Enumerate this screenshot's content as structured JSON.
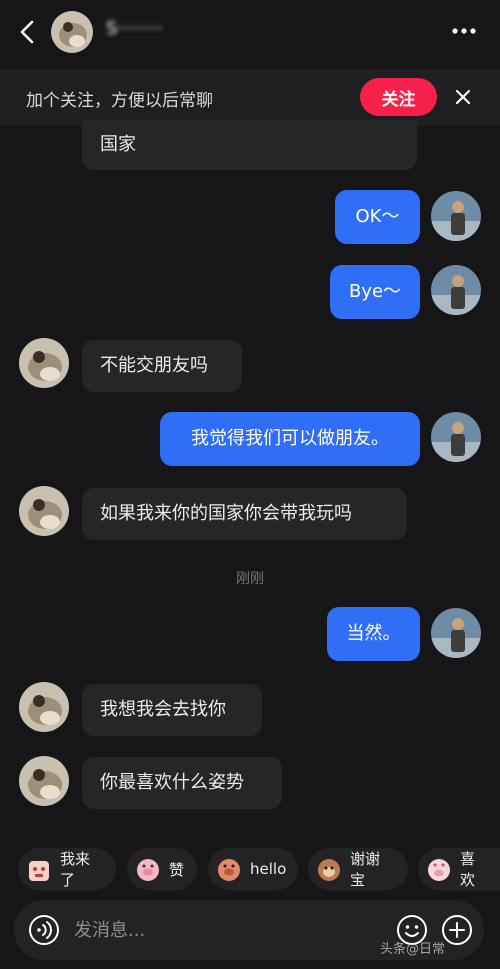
{
  "header": {
    "contact_name": "S········"
  },
  "follow_banner": {
    "text": "加个关注，方便以后常聊",
    "button_label": "关注"
  },
  "messages": [
    {
      "side": "left",
      "text": "国家"
    },
    {
      "side": "right",
      "text": "OK～"
    },
    {
      "side": "right",
      "text": "Bye～"
    },
    {
      "side": "left",
      "text": "不能交朋友吗"
    },
    {
      "side": "right",
      "text": "我觉得我们可以做朋友。"
    },
    {
      "side": "left",
      "text": "如果我来你的国家你会带我玩吗"
    },
    {
      "side": "right",
      "text": "当然。"
    },
    {
      "side": "left",
      "text": "我想我会去找你"
    },
    {
      "side": "left",
      "text": "你最喜欢什么姿势"
    }
  ],
  "timestamp": "刚刚",
  "quick_replies": [
    {
      "label": "我来了",
      "icon": "bear-emoji-icon"
    },
    {
      "label": "赞",
      "icon": "pig-emoji-icon"
    },
    {
      "label": "hello",
      "icon": "pig-face-emoji-icon"
    },
    {
      "label": "谢谢宝",
      "icon": "monkey-emoji-icon"
    },
    {
      "label": "喜欢",
      "icon": "pig-heart-emoji-icon"
    }
  ],
  "input": {
    "placeholder": "发消息..."
  },
  "watermark": "头条@日常",
  "colors": {
    "accent_blue": "#2f6ef5",
    "follow_red": "#f7204a",
    "background": "#161618"
  }
}
